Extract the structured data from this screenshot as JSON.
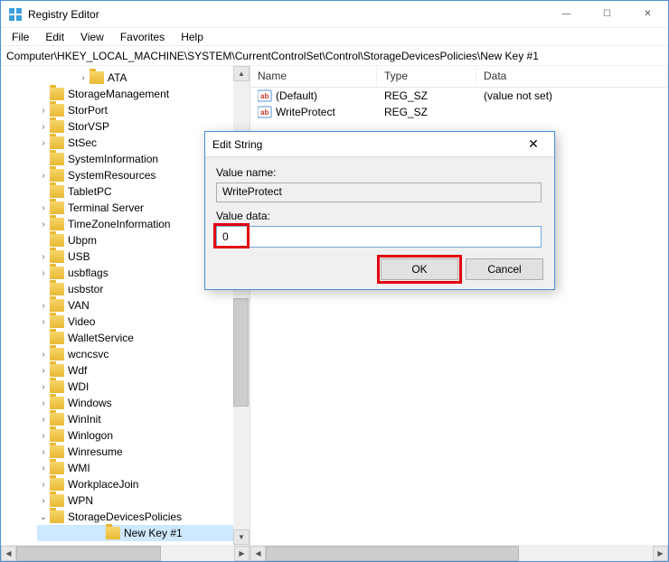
{
  "window": {
    "title": "Registry Editor"
  },
  "menu": {
    "file": "File",
    "edit": "Edit",
    "view": "View",
    "favorites": "Favorites",
    "help": "Help"
  },
  "address": "Computer\\HKEY_LOCAL_MACHINE\\SYSTEM\\CurrentControlSet\\Control\\StorageDevicesPolicies\\New Key #1",
  "tree": [
    {
      "label": "ATA",
      "tw": "›",
      "indent": 1
    },
    {
      "label": "StorageManagement",
      "tw": "",
      "indent": 0
    },
    {
      "label": "StorPort",
      "tw": "›",
      "indent": 0
    },
    {
      "label": "StorVSP",
      "tw": "›",
      "indent": 0
    },
    {
      "label": "StSec",
      "tw": "›",
      "indent": 0
    },
    {
      "label": "SystemInformation",
      "tw": "",
      "indent": 0
    },
    {
      "label": "SystemResources",
      "tw": "›",
      "indent": 0
    },
    {
      "label": "TabletPC",
      "tw": "",
      "indent": 0
    },
    {
      "label": "Terminal Server",
      "tw": "›",
      "indent": 0
    },
    {
      "label": "TimeZoneInformation",
      "tw": "›",
      "indent": 0
    },
    {
      "label": "Ubpm",
      "tw": "",
      "indent": 0
    },
    {
      "label": "USB",
      "tw": "›",
      "indent": 0
    },
    {
      "label": "usbflags",
      "tw": "›",
      "indent": 0
    },
    {
      "label": "usbstor",
      "tw": "",
      "indent": 0
    },
    {
      "label": "VAN",
      "tw": "›",
      "indent": 0
    },
    {
      "label": "Video",
      "tw": "›",
      "indent": 0
    },
    {
      "label": "WalletService",
      "tw": "",
      "indent": 0
    },
    {
      "label": "wcncsvc",
      "tw": "›",
      "indent": 0
    },
    {
      "label": "Wdf",
      "tw": "›",
      "indent": 0
    },
    {
      "label": "WDI",
      "tw": "›",
      "indent": 0
    },
    {
      "label": "Windows",
      "tw": "›",
      "indent": 0
    },
    {
      "label": "WinInit",
      "tw": "›",
      "indent": 0
    },
    {
      "label": "Winlogon",
      "tw": "›",
      "indent": 0
    },
    {
      "label": "Winresume",
      "tw": "›",
      "indent": 0
    },
    {
      "label": "WMI",
      "tw": "›",
      "indent": 0
    },
    {
      "label": "WorkplaceJoin",
      "tw": "›",
      "indent": 0
    },
    {
      "label": "WPN",
      "tw": "›",
      "indent": 0
    },
    {
      "label": "StorageDevicesPolicies",
      "tw": "⌄",
      "indent": 0
    },
    {
      "label": "New Key #1",
      "tw": "",
      "indent": 2,
      "selected": true
    }
  ],
  "list": {
    "head": {
      "name": "Name",
      "type": "Type",
      "data": "Data"
    },
    "rows": [
      {
        "name": "(Default)",
        "type": "REG_SZ",
        "data": "(value not set)"
      },
      {
        "name": "WriteProtect",
        "type": "REG_SZ",
        "data": ""
      }
    ]
  },
  "dialog": {
    "title": "Edit String",
    "value_name_label": "Value name:",
    "value_name": "WriteProtect",
    "value_data_label": "Value data:",
    "value_data": "0",
    "ok": "OK",
    "cancel": "Cancel"
  }
}
